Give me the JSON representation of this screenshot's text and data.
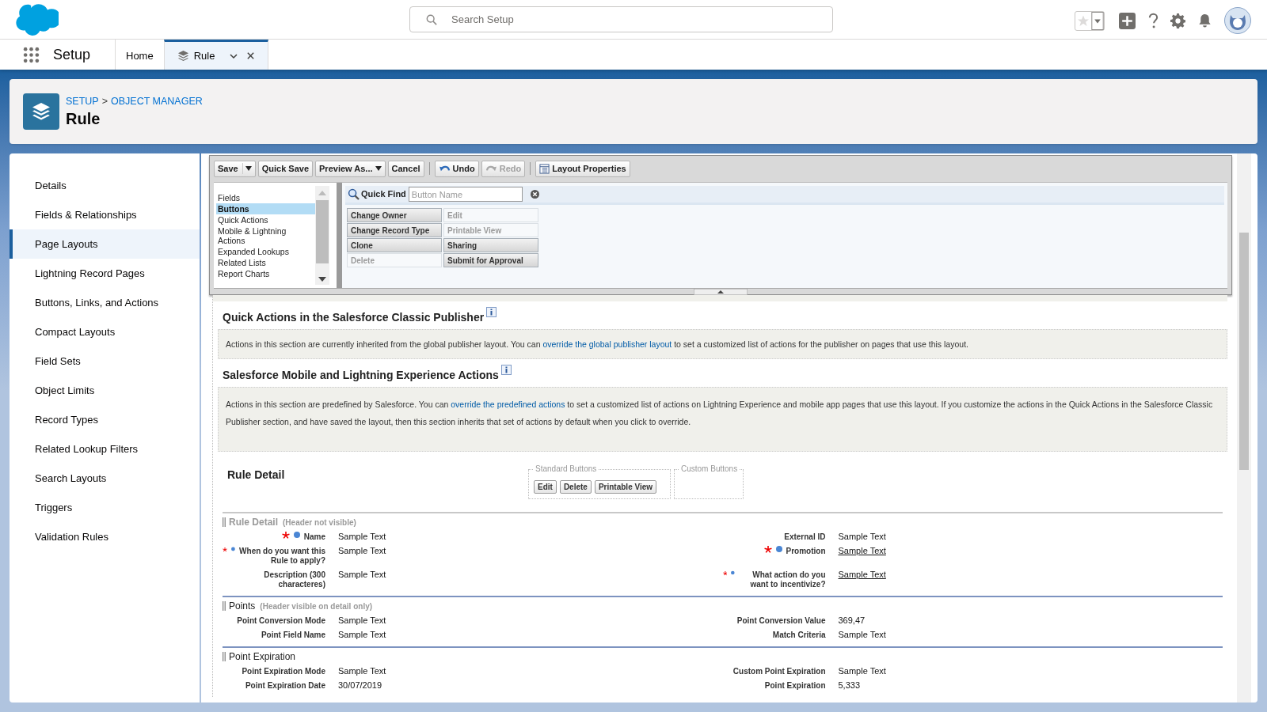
{
  "topbar": {
    "search_placeholder": "Search Setup"
  },
  "nav": {
    "app_name": "Setup",
    "tabs": [
      {
        "label": "Home",
        "kind": "home",
        "selected": false
      },
      {
        "label": "Rule",
        "kind": "record",
        "selected": true
      }
    ]
  },
  "page_header": {
    "breadcrumbs": [
      "SETUP",
      "OBJECT MANAGER"
    ],
    "separator": ">",
    "title": "Rule"
  },
  "sidebar": {
    "items": [
      {
        "label": "Details",
        "selected": false
      },
      {
        "label": "Fields & Relationships",
        "selected": false
      },
      {
        "label": "Page Layouts",
        "selected": true
      },
      {
        "label": "Lightning Record Pages",
        "selected": false
      },
      {
        "label": "Buttons, Links, and Actions",
        "selected": false
      },
      {
        "label": "Compact Layouts",
        "selected": false
      },
      {
        "label": "Field Sets",
        "selected": false
      },
      {
        "label": "Object Limits",
        "selected": false
      },
      {
        "label": "Record Types",
        "selected": false
      },
      {
        "label": "Related Lookup Filters",
        "selected": false
      },
      {
        "label": "Search Layouts",
        "selected": false
      },
      {
        "label": "Triggers",
        "selected": false
      },
      {
        "label": "Validation Rules",
        "selected": false
      }
    ]
  },
  "editor": {
    "toolbar": [
      {
        "label": "Save",
        "kind": "split",
        "disabled": false
      },
      {
        "label": "Quick Save",
        "kind": "plain",
        "disabled": false
      },
      {
        "label": "Preview As...",
        "kind": "menu",
        "disabled": false
      },
      {
        "label": "Cancel",
        "kind": "plain",
        "disabled": false
      },
      {
        "label": "Undo",
        "kind": "undo",
        "disabled": false
      },
      {
        "label": "Redo",
        "kind": "redo",
        "disabled": true
      },
      {
        "label": "Layout Properties",
        "kind": "properties",
        "disabled": false
      }
    ],
    "categories": [
      {
        "label": "Fields",
        "selected": false
      },
      {
        "label": "Buttons",
        "selected": true
      },
      {
        "label": "Quick Actions",
        "selected": false
      },
      {
        "label": "Mobile & Lightning Actions",
        "selected": false
      },
      {
        "label": "Expanded Lookups",
        "selected": false
      },
      {
        "label": "Related Lists",
        "selected": false
      },
      {
        "label": "Report Charts",
        "selected": false
      }
    ],
    "quick_find": {
      "label": "Quick Find",
      "placeholder": "Button Name"
    },
    "items": [
      {
        "label": "Change Owner",
        "used": false
      },
      {
        "label": "Edit",
        "used": true
      },
      {
        "label": "Change Record Type",
        "used": false
      },
      {
        "label": "Printable View",
        "used": true
      },
      {
        "label": "Clone",
        "used": false
      },
      {
        "label": "Sharing",
        "used": false
      },
      {
        "label": "Delete",
        "used": true
      },
      {
        "label": "Submit for Approval",
        "used": false
      }
    ]
  },
  "notices": [
    {
      "title": "Quick Actions in the Salesforce Classic Publisher",
      "before": "Actions in this section are currently inherited from the global publisher layout. You can ",
      "link": "override the global publisher layout",
      "after": " to set a customized list of actions for the publisher on pages that use this layout."
    },
    {
      "title": "Salesforce Mobile and Lightning Experience Actions",
      "before": "Actions in this section are predefined by Salesforce. You can ",
      "link": "override the predefined actions",
      "after": " to set a customized list of actions on Lightning Experience and mobile app pages that use this layout. If you customize the actions in the Quick Actions in the Salesforce Classic Publisher section, and have saved the layout, then this section inherits that set of actions by default when you click to override."
    }
  ],
  "detail": {
    "title": "Rule Detail",
    "standard_label": "Standard Buttons",
    "standard_buttons": [
      "Edit",
      "Delete",
      "Printable View"
    ],
    "custom_label": "Custom Buttons"
  },
  "field_sections": [
    {
      "title": "Rule Detail",
      "note": "(Header not visible)",
      "header_visible": false,
      "rows": [
        {
          "left": {
            "label": "Name",
            "value": "Sample Text",
            "required": true,
            "kind": "text"
          },
          "right": {
            "label": "External ID",
            "value": "Sample Text",
            "required": false,
            "kind": "text"
          }
        },
        {
          "left": {
            "label": "When do you want this Rule to apply?",
            "value": "Sample Text",
            "required": true,
            "kind": "text"
          },
          "right": {
            "label": "Promotion",
            "value": "Sample Text",
            "required": true,
            "kind": "lookup"
          }
        },
        {
          "left": {
            "label": "Description (300 characteres)",
            "value": "Sample Text",
            "required": false,
            "kind": "text"
          },
          "right": {
            "label": "What action do you want to incentivize?",
            "value": "Sample Text",
            "required": true,
            "kind": "lookup"
          }
        }
      ]
    },
    {
      "title": "Points",
      "note": "(Header visible on detail only)",
      "header_visible": true,
      "rows": [
        {
          "left": {
            "label": "Point Conversion Mode",
            "value": "Sample Text",
            "required": false,
            "kind": "text"
          },
          "right": {
            "label": "Point Conversion Value",
            "value": "369,47",
            "required": false,
            "kind": "text"
          }
        },
        {
          "left": {
            "label": "Point Field Name",
            "value": "Sample Text",
            "required": false,
            "kind": "text"
          },
          "right": {
            "label": "Match Criteria",
            "value": "Sample Text",
            "required": false,
            "kind": "text"
          }
        }
      ]
    },
    {
      "title": "Point Expiration",
      "header_visible": true,
      "rows": [
        {
          "left": {
            "label": "Point Expiration Mode",
            "value": "Sample Text",
            "required": false,
            "kind": "text"
          },
          "right": {
            "label": "Custom Point Expiration",
            "value": "Sample Text",
            "required": false,
            "kind": "text"
          }
        },
        {
          "left": {
            "label": "Point Expiration Date",
            "value": "30/07/2019",
            "required": false,
            "kind": "text"
          },
          "right": {
            "label": "Point Expiration",
            "value": "5,333",
            "required": false,
            "kind": "text"
          }
        }
      ]
    }
  ]
}
